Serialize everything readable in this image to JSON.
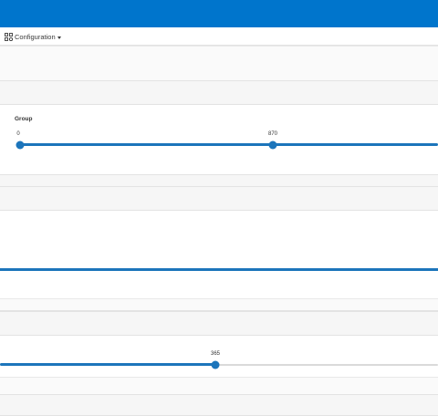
{
  "toolbar": {
    "configuration_label": "Configuration",
    "configuration_icon": "configuration-grid-icon"
  },
  "filters": {
    "group": {
      "label": "Group",
      "start_value_label": "0",
      "thumb_value_label": "870"
    },
    "second_slider": {
      "thumb_value_label": "365"
    }
  },
  "colors": {
    "header": "#0075cc",
    "slider": "#1c75bb",
    "band": "#f6f6f6"
  }
}
